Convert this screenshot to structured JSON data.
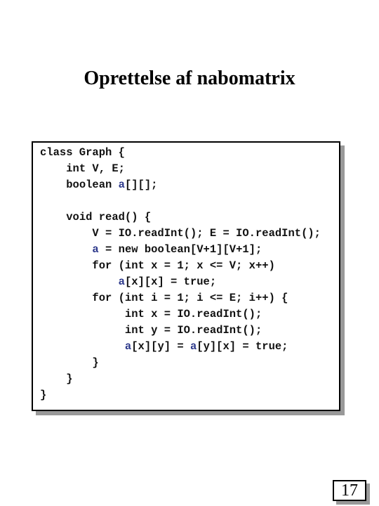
{
  "slide": {
    "title": "Oprettelse af nabomatrix",
    "page_number": "17"
  },
  "code": {
    "lines": [
      {
        "indent": 0,
        "segments": [
          {
            "t": "class Graph {"
          }
        ]
      },
      {
        "indent": 1,
        "segments": [
          {
            "t": "int V, E;"
          }
        ]
      },
      {
        "indent": 1,
        "segments": [
          {
            "t": "boolean "
          },
          {
            "t": "a",
            "hl": true
          },
          {
            "t": "[][];"
          }
        ]
      },
      {
        "indent": 0,
        "segments": [
          {
            "t": ""
          }
        ]
      },
      {
        "indent": 1,
        "segments": [
          {
            "t": "void read() {"
          }
        ]
      },
      {
        "indent": 2,
        "segments": [
          {
            "t": "V = IO.readInt(); E = IO.readInt();"
          }
        ]
      },
      {
        "indent": 2,
        "segments": [
          {
            "t": "a",
            "hl": true
          },
          {
            "t": " = new boolean[V+1][V+1];"
          }
        ]
      },
      {
        "indent": 2,
        "segments": [
          {
            "t": "for (int x = 1; x <= V; x++)"
          }
        ]
      },
      {
        "indent": 3,
        "segments": [
          {
            "t": "a",
            "hl": true
          },
          {
            "t": "[x][x] = true;"
          }
        ]
      },
      {
        "indent": 2,
        "segments": [
          {
            "t": "for (int i = 1; i <= E; i++) {"
          }
        ]
      },
      {
        "indent": 3,
        "extra": 1,
        "segments": [
          {
            "t": "int x = IO.readInt();"
          }
        ]
      },
      {
        "indent": 3,
        "extra": 1,
        "segments": [
          {
            "t": "int y = IO.readInt();"
          }
        ]
      },
      {
        "indent": 3,
        "extra": 1,
        "segments": [
          {
            "t": "a",
            "hl": true
          },
          {
            "t": "[x][y] = "
          },
          {
            "t": "a",
            "hl": true
          },
          {
            "t": "[y][x] = true;"
          }
        ]
      },
      {
        "indent": 2,
        "segments": [
          {
            "t": "}"
          }
        ]
      },
      {
        "indent": 1,
        "segments": [
          {
            "t": "}"
          }
        ]
      },
      {
        "indent": 0,
        "segments": [
          {
            "t": "}"
          }
        ]
      }
    ]
  },
  "colors": {
    "highlight": "#2e3a8c",
    "shadow": "#999999"
  }
}
